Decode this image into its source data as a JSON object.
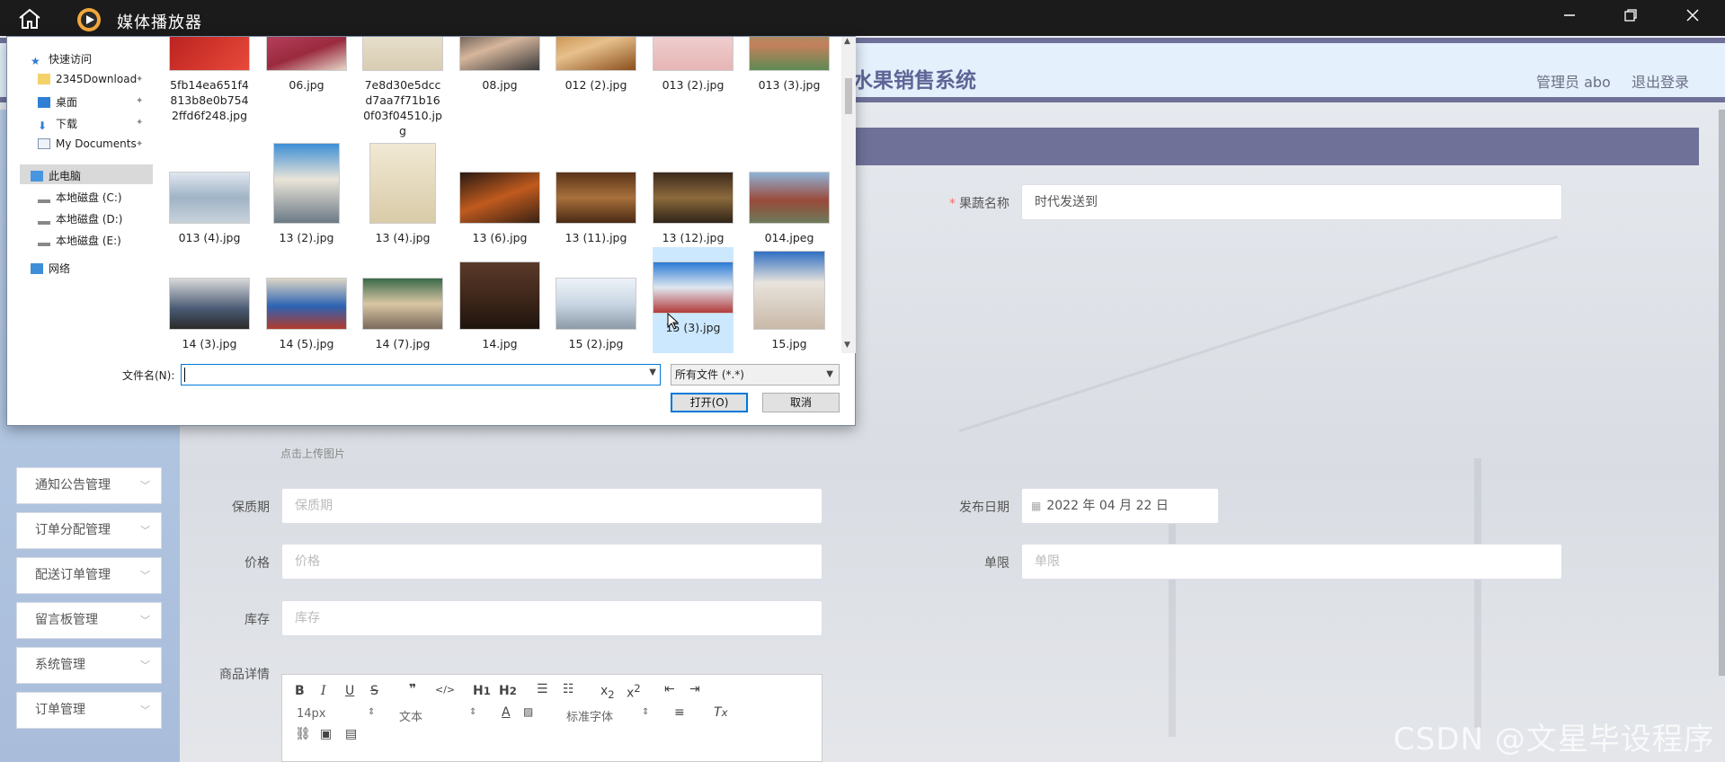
{
  "window": {
    "title": "媒体播放器"
  },
  "app": {
    "system_title": "水果销售系统",
    "user": "管理员 abo",
    "logout": "退出登录",
    "menu": [
      "通知公告管理",
      "订单分配管理",
      "配送订单管理",
      "留言板管理",
      "系统管理",
      "订单管理"
    ],
    "form": {
      "name_label": "果蔬名称",
      "name_value": "时代发送到",
      "upload_hint": "点击上传图片",
      "shelf_label": "保质期",
      "shelf_placeholder": "保质期",
      "date_label": "发布日期",
      "date_value": "2022 年 04 月 22 日",
      "price_label": "价格",
      "price_placeholder": "价格",
      "unit_label": "单限",
      "unit_placeholder": "单限",
      "stock_label": "库存",
      "stock_placeholder": "库存",
      "detail_label": "商品详情"
    },
    "editor": {
      "font_size": "14px",
      "text_type": "文本",
      "font_family": "标准字体"
    },
    "watermark": "CSDN @文星毕设程序"
  },
  "dialog": {
    "nav": {
      "quick_access": "快速访问",
      "items": [
        "2345Download",
        "桌面",
        "下载",
        "My Documents"
      ],
      "this_pc": "此电脑",
      "drives": [
        "本地磁盘 (C:)",
        "本地磁盘 (D:)",
        "本地磁盘 (E:)"
      ],
      "network": "网络"
    },
    "files_row1": [
      "5fb14ea651f4813b8e0b7542ffd6f248.jpg",
      "06.jpg",
      "7e8d30e5dccd7aa7f71b160f03f04510.jpg",
      "08.jpg",
      "012 (2).jpg",
      "013 (2).jpg",
      "013 (3).jpg"
    ],
    "files_row2": [
      "013 (4).jpg",
      "13 (2).jpg",
      "13 (4).jpg",
      "13 (6).jpg",
      "13 (11).jpg",
      "13 (12).jpg",
      "014.jpeg"
    ],
    "files_row3": [
      "14 (3).jpg",
      "14 (5).jpg",
      "14 (7).jpg",
      "14.jpg",
      "15 (2).jpg",
      "15 (3).jpg",
      "15.jpg"
    ],
    "filename_label": "文件名(N):",
    "filename_value": "",
    "filetype": "所有文件 (*.*)",
    "open_button": "打开(O)",
    "cancel_button": "取消"
  }
}
